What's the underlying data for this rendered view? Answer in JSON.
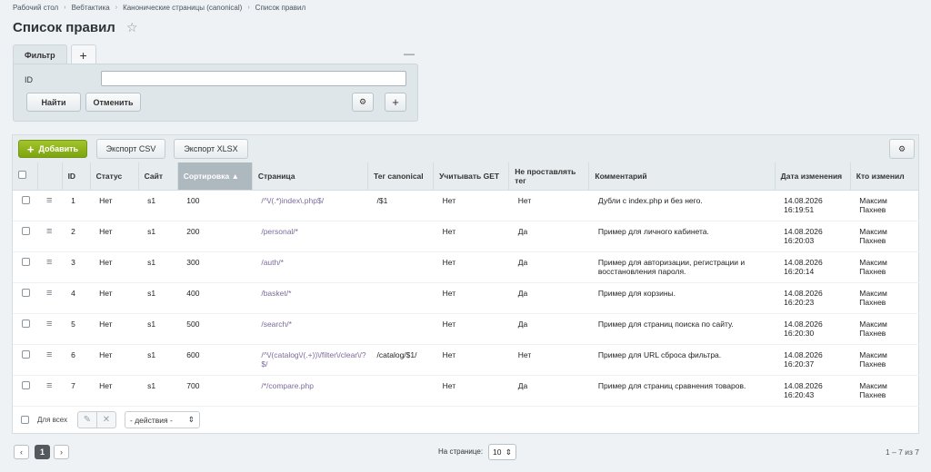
{
  "breadcrumb": [
    "Рабочий стол",
    "Вебтактика",
    "Канонические страницы (canonical)",
    "Список правил"
  ],
  "page": {
    "title": "Список правил"
  },
  "filter": {
    "tab_label": "Фильтр",
    "field_label": "ID",
    "field_value": "",
    "find_label": "Найти",
    "cancel_label": "Отменить"
  },
  "toolbar": {
    "add_label": "Добавить",
    "export_csv_label": "Экспорт CSV",
    "export_xlsx_label": "Экспорт XLSX"
  },
  "table": {
    "headers": [
      "ID",
      "Статус",
      "Сайт",
      "Сортировка",
      "Страница",
      "Тег canonical",
      "Учитывать GET",
      "Не проставлять тег",
      "Комментарий",
      "Дата изменения",
      "Кто изменил"
    ],
    "sort_indicator": "▲",
    "rows": [
      {
        "id": "1",
        "status": "Нет",
        "site": "s1",
        "sort": "100",
        "page": "/^\\/(.*)index\\.php$/",
        "canonical": "/$1",
        "get": "Нет",
        "no_tag": "Нет",
        "comment": "Дубли с index.php и без него.",
        "date": "14.08.2026",
        "time": "16:19:51",
        "user_first": "Максим",
        "user_last": "Пахнев"
      },
      {
        "id": "2",
        "status": "Нет",
        "site": "s1",
        "sort": "200",
        "page": "/personal/*",
        "canonical": "",
        "get": "Нет",
        "no_tag": "Да",
        "comment": "Пример для личного кабинета.",
        "date": "14.08.2026",
        "time": "16:20:03",
        "user_first": "Максим",
        "user_last": "Пахнев"
      },
      {
        "id": "3",
        "status": "Нет",
        "site": "s1",
        "sort": "300",
        "page": "/auth/*",
        "canonical": "",
        "get": "Нет",
        "no_tag": "Да",
        "comment": "Пример для авторизации, регистрации и восстановления пароля.",
        "date": "14.08.2026",
        "time": "16:20:14",
        "user_first": "Максим",
        "user_last": "Пахнев"
      },
      {
        "id": "4",
        "status": "Нет",
        "site": "s1",
        "sort": "400",
        "page": "/basket/*",
        "canonical": "",
        "get": "Нет",
        "no_tag": "Да",
        "comment": "Пример для корзины.",
        "date": "14.08.2026",
        "time": "16:20:23",
        "user_first": "Максим",
        "user_last": "Пахнев"
      },
      {
        "id": "5",
        "status": "Нет",
        "site": "s1",
        "sort": "500",
        "page": "/search/*",
        "canonical": "",
        "get": "Нет",
        "no_tag": "Да",
        "comment": "Пример для страниц поиска по сайту.",
        "date": "14.08.2026",
        "time": "16:20:30",
        "user_first": "Максим",
        "user_last": "Пахнев"
      },
      {
        "id": "6",
        "status": "Нет",
        "site": "s1",
        "sort": "600",
        "page": "/^\\/(catalog\\/(.+))\\/filter\\/clear\\/?$/",
        "canonical": "/catalog/$1/",
        "get": "Нет",
        "no_tag": "Нет",
        "comment": "Пример для URL сброса фильтра.",
        "date": "14.08.2026",
        "time": "16:20:37",
        "user_first": "Максим",
        "user_last": "Пахнев"
      },
      {
        "id": "7",
        "status": "Нет",
        "site": "s1",
        "sort": "700",
        "page": "/*/compare.php",
        "canonical": "",
        "get": "Нет",
        "no_tag": "Да",
        "comment": "Пример для страниц сравнения товаров.",
        "date": "14.08.2026",
        "time": "16:20:43",
        "user_first": "Максим",
        "user_last": "Пахнев"
      }
    ]
  },
  "footer": {
    "select_all_label": "Для всех",
    "actions_label": "- действия -"
  },
  "pagination": {
    "current_page": "1",
    "per_page_label": "На странице:",
    "per_page_value": "10",
    "total_label": "1 – 7 из 7"
  }
}
